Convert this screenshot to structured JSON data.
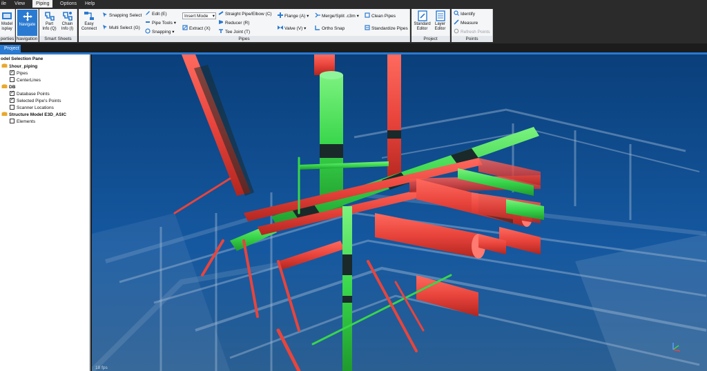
{
  "menu": {
    "items": [
      "ile",
      "View",
      "Piping",
      "Options",
      "Help"
    ],
    "active": "Piping"
  },
  "ribbon": {
    "model_display": {
      "label_line1": "Model",
      "label_line2": "isplay"
    },
    "properties_group_label": "perties",
    "navigate": {
      "label": "Navigate"
    },
    "navigation_group_label": "Navigation",
    "part_info": {
      "line1": "Part",
      "line2": "Info (Q)"
    },
    "chain_info": {
      "line1": "Chain",
      "line2": "Info (I)"
    },
    "smart_sheets_label": "Smart Sheets",
    "easy_connect": {
      "line1": "Easy",
      "line2": "Connect"
    },
    "snapping_select": "Snapping Select",
    "multi_select": "Multi Select (G)",
    "edit": "Edit (E)",
    "pipe_tools": "Pipe Tools",
    "snapping": "Snapping",
    "mode_select_value": "Insert Mode",
    "extract": "Extract (X)",
    "straight_pipe": "Straight Pipe/Elbow (C)",
    "reducer": "Reducer (R)",
    "tee_joint": "Tee Joint (T)",
    "flange": "Flange (A)",
    "valve": "Valve (V)",
    "merge_split": "Merge/Split .c3m",
    "ortho_snap": "Ortho Snap",
    "clean_pipes": "Clean Pipes",
    "standardize_pipes": "Standardize Pipes",
    "pipes_group_label": "Pipes",
    "standard_editor": {
      "line1": "Standard",
      "line2": "Editor"
    },
    "layer_editor": {
      "line1": "Layer",
      "line2": "Editor"
    },
    "project_group_label": "Project",
    "identify": "Identify",
    "measure": "Measure",
    "refresh_points": "Refresh Points",
    "points_group_label": "Points"
  },
  "tabs": {
    "project": "Project"
  },
  "pane": {
    "title": "odel Selection Pane",
    "tree": [
      {
        "label": "1hour_piping",
        "bold": true,
        "type": "db"
      },
      {
        "label": "Pipes",
        "checked": true
      },
      {
        "label": "CenterLines",
        "checked": false
      },
      {
        "label": "DB",
        "bold": true,
        "type": "db"
      },
      {
        "label": "Database Points",
        "checked": true
      },
      {
        "label": "Selected Pipe's Points",
        "checked": true
      },
      {
        "label": "Scanner Locations",
        "checked": false
      },
      {
        "label": "Structure Model E3D_ASIC",
        "bold": true,
        "type": "db"
      },
      {
        "label": "Elements",
        "checked": false
      }
    ]
  },
  "viewport": {
    "fps": "18 fps",
    "colors": {
      "background": "#0f4f8e",
      "pipe_red": "#e8443c",
      "pipe_green": "#39d64b",
      "pipe_dark": "#1a2a2a",
      "structure": "#8fa9c4"
    }
  }
}
